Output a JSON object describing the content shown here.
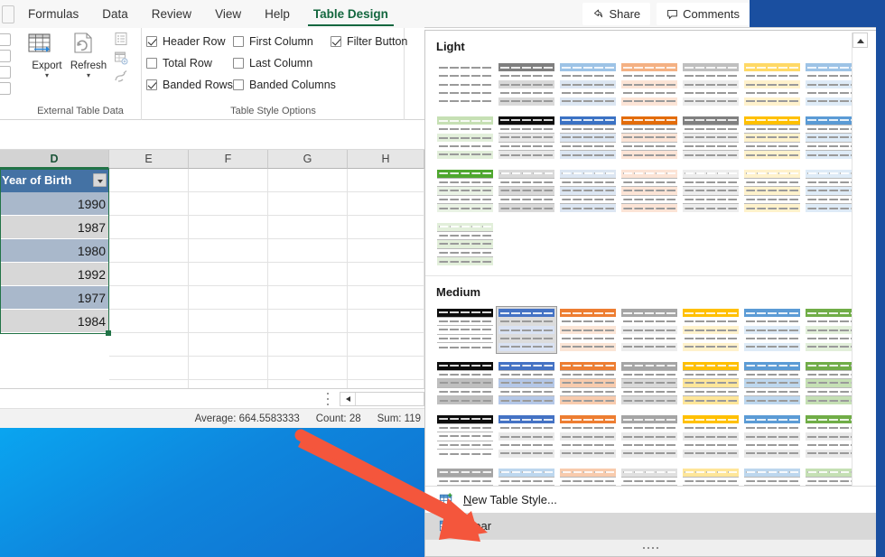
{
  "ribbon": {
    "tabs": [
      {
        "label": "Formulas",
        "active": false
      },
      {
        "label": "Data",
        "active": false
      },
      {
        "label": "Review",
        "active": false
      },
      {
        "label": "View",
        "active": false
      },
      {
        "label": "Help",
        "active": false
      },
      {
        "label": "Table Design",
        "active": true
      }
    ],
    "share_label": "Share",
    "comments_label": "Comments",
    "groups": {
      "external": {
        "label": "External Table Data",
        "buttons": [
          {
            "label": "Export",
            "icon": "export-table-icon"
          },
          {
            "label": "Refresh",
            "icon": "refresh-icon"
          }
        ],
        "small_icons": [
          "properties-icon",
          "open-in-browser-icon",
          "unlink-icon"
        ]
      },
      "table_style_options": {
        "label": "Table Style Options",
        "checkboxes": [
          {
            "label": "Header Row",
            "checked": true
          },
          {
            "label": "Total Row",
            "checked": false
          },
          {
            "label": "Banded Rows",
            "checked": true
          },
          {
            "label": "First Column",
            "checked": false
          },
          {
            "label": "Last Column",
            "checked": false
          },
          {
            "label": "Banded Columns",
            "checked": false
          },
          {
            "label": "Filter Button",
            "checked": true
          }
        ]
      }
    }
  },
  "sheet": {
    "column_headers": [
      "D",
      "E",
      "F",
      "G",
      "H"
    ],
    "selected_column": "D",
    "table": {
      "header": "Year of Birth",
      "rows": [
        "1990",
        "1987",
        "1980",
        "1992",
        "1977",
        "1984"
      ]
    }
  },
  "status_bar": {
    "average": "Average: 664.5583333",
    "count": "Count: 28",
    "sum": "Sum: 119"
  },
  "gallery": {
    "sections": [
      {
        "title": "Light",
        "rows": [
          [
            {
              "header": "",
              "band": "",
              "border": "none",
              "sel": false
            },
            {
              "header": "#7f7f7f",
              "band": "#d9d9d9",
              "border": "none",
              "sel": false
            },
            {
              "header": "#9dc3e6",
              "band": "#dce6f2",
              "border": "none",
              "sel": false
            },
            {
              "header": "#f4b183",
              "band": "#fce4d6",
              "border": "none",
              "sel": false
            },
            {
              "header": "#bfbfbf",
              "band": "#ededed",
              "border": "none",
              "sel": false
            },
            {
              "header": "#ffd966",
              "band": "#fff2cc",
              "border": "none",
              "sel": false
            },
            {
              "header": "#9dc3e6",
              "band": "#deebf7",
              "border": "none",
              "sel": false
            }
          ],
          [
            {
              "header": "#c6e0b4",
              "band": "#e2efda",
              "border": "none",
              "sel": false
            },
            {
              "header": "#0d0d0d",
              "band": "#e8e8e8",
              "border": "row",
              "sel": false
            },
            {
              "header": "#3b72c4",
              "band": "#dce6f2",
              "border": "row",
              "sel": false
            },
            {
              "header": "#e36c0a",
              "band": "#fce4d6",
              "border": "row",
              "sel": false
            },
            {
              "header": "#808080",
              "band": "#ededed",
              "border": "row",
              "sel": false
            },
            {
              "header": "#ffc000",
              "band": "#fff2cc",
              "border": "row",
              "sel": false
            },
            {
              "header": "#5b9bd5",
              "band": "#deebf7",
              "border": "row",
              "sel": false
            }
          ],
          [
            {
              "header": "#4ea72e",
              "band": "#e9f2e4",
              "border": "grid",
              "sel": false
            },
            {
              "header": "#d9d9d9",
              "band": "#d9d9d9",
              "border": "grid",
              "sel": false
            },
            {
              "header": "#dce6f2",
              "band": "#dce6f2",
              "border": "grid",
              "sel": false
            },
            {
              "header": "#fce4d6",
              "band": "#fce4d6",
              "border": "grid",
              "sel": false
            },
            {
              "header": "#ededed",
              "band": "#ededed",
              "border": "grid",
              "sel": false
            },
            {
              "header": "#fff2cc",
              "band": "#fff2cc",
              "border": "grid",
              "sel": false
            },
            {
              "header": "#deebf7",
              "band": "#deebf7",
              "border": "grid",
              "sel": false
            }
          ],
          [
            {
              "header": "#e2efda",
              "band": "#e2efda",
              "border": "grid",
              "sel": false
            }
          ]
        ]
      },
      {
        "title": "Medium",
        "rows": [
          [
            {
              "header": "#0d0d0d",
              "band": "#ffffff",
              "border": "row",
              "sel": false
            },
            {
              "header": "#4472c4",
              "band": "#d9e2f3",
              "border": "none",
              "sel": true
            },
            {
              "header": "#ed7d31",
              "band": "#fbe5d6",
              "border": "none",
              "sel": false
            },
            {
              "header": "#a5a5a5",
              "band": "#ededed",
              "border": "none",
              "sel": false
            },
            {
              "header": "#ffc000",
              "band": "#fff2cc",
              "border": "none",
              "sel": false
            },
            {
              "header": "#5b9bd5",
              "band": "#deebf7",
              "border": "none",
              "sel": false
            },
            {
              "header": "#70ad47",
              "band": "#e2efda",
              "border": "none",
              "sel": false
            }
          ],
          [
            {
              "header": "#0d0d0d",
              "band": "#bfbfbf",
              "border": "grid",
              "sel": false
            },
            {
              "header": "#4472c4",
              "band": "#b4c7e7",
              "border": "grid",
              "sel": false
            },
            {
              "header": "#ed7d31",
              "band": "#f8cbad",
              "border": "grid",
              "sel": false
            },
            {
              "header": "#a5a5a5",
              "band": "#d9d9d9",
              "border": "grid",
              "sel": false
            },
            {
              "header": "#ffc000",
              "band": "#ffe699",
              "border": "grid",
              "sel": false
            },
            {
              "header": "#5b9bd5",
              "band": "#bdd7ee",
              "border": "grid",
              "sel": false
            },
            {
              "header": "#70ad47",
              "band": "#c5e0b4",
              "border": "grid",
              "sel": false
            }
          ],
          [
            {
              "header": "#0d0d0d",
              "band": "#ffffff",
              "border": "grid",
              "sel": false
            },
            {
              "header": "#4472c4",
              "band": "#e9e9e9",
              "border": "none",
              "sel": false
            },
            {
              "header": "#ed7d31",
              "band": "#e9e9e9",
              "border": "none",
              "sel": false
            },
            {
              "header": "#a5a5a5",
              "band": "#e9e9e9",
              "border": "none",
              "sel": false
            },
            {
              "header": "#ffc000",
              "band": "#e9e9e9",
              "border": "none",
              "sel": false
            },
            {
              "header": "#5b9bd5",
              "band": "#e9e9e9",
              "border": "none",
              "sel": false
            },
            {
              "header": "#70ad47",
              "band": "#e9e9e9",
              "border": "none",
              "sel": false
            }
          ],
          [
            {
              "header": "#a5a5a5",
              "band": "#bfbfbf",
              "border": "grid",
              "sel": false
            },
            {
              "header": "#bdd7ee",
              "band": "#bdd7ee",
              "border": "grid",
              "sel": false
            },
            {
              "header": "#f8cbad",
              "band": "#f8cbad",
              "border": "grid",
              "sel": false
            },
            {
              "header": "#e0e0e0",
              "band": "#e0e0e0",
              "border": "grid",
              "sel": false
            },
            {
              "header": "#ffe699",
              "band": "#ffe699",
              "border": "grid",
              "sel": false
            },
            {
              "header": "#bdd7ee",
              "band": "#bdd7ee",
              "border": "grid",
              "sel": false
            },
            {
              "header": "#c5e0b4",
              "band": "#c5e0b4",
              "border": "grid",
              "sel": false
            }
          ]
        ]
      }
    ],
    "commands": [
      {
        "label": "New Table Style...",
        "icon": "new-table-style-icon",
        "hover": false
      },
      {
        "label": "Clear",
        "icon": "clear-table-style-icon",
        "hover": true
      }
    ]
  },
  "colors": {
    "accent_green": "#14673f",
    "table_header_blue": "#4472a4",
    "desktop_blue": "#0e86dd",
    "window_blue": "#1a4fa0",
    "arrow_red": "#f4563c"
  }
}
